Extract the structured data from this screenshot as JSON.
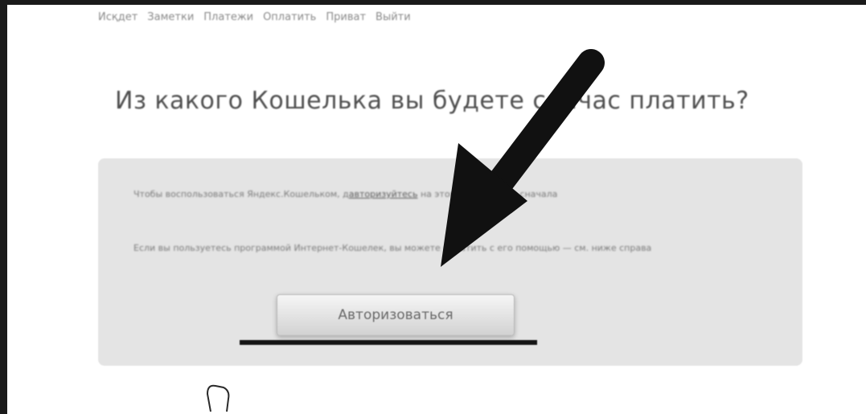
{
  "nav": {
    "items": [
      "Исқдет",
      "Заметки",
      "Платежи",
      "Оплатить",
      "Приват",
      "Выйти"
    ]
  },
  "title": "Из какого Кошелька вы будете сейчас платить?",
  "panel": {
    "para1_before": "Чтобы воспользоваться Яндекс.Кошельком, д",
    "para1_link": "авторизуйтесь",
    "para1_after": " на этом компьютере сначала",
    "para2": "Если вы пользуетесь программой Интернет-Кошелек, вы можете оплатить с его помощью — см. ниже справа",
    "button_label": "Авторизоваться"
  },
  "colors": {
    "panel_bg": "#e4e4e4",
    "arrow": "#111111",
    "frame": "#1a1a1a"
  },
  "icons": {
    "arrow": "annotation-arrow-icon",
    "cursor": "hand-cursor-icon"
  }
}
